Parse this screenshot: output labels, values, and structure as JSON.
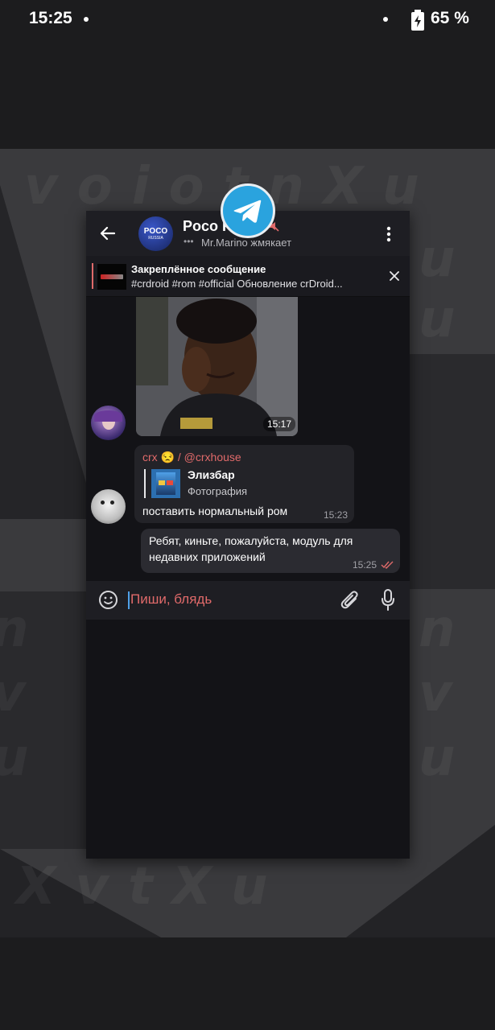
{
  "status_bar": {
    "time": "15:25",
    "battery": "65 %"
  },
  "chat": {
    "title": "Poco R",
    "typing_text": "Mr.Marino жмякает",
    "avatar_text": "POCO",
    "avatar_sub": "RUSSIA"
  },
  "pinned": {
    "title": "Закреплённое сообщение",
    "text": "#crdroid #rom #official Обновление crDroid..."
  },
  "messages": {
    "photo_time": "15:17",
    "reply": {
      "sender": "crx 😒 / @crxhouse",
      "quoted_name": "Элизбар",
      "quoted_type": "Фотография",
      "text": "поставить нормальный ром",
      "time": "15:23"
    },
    "outgoing": {
      "text_line1": "Ребят, киньте, пожалуйста, модуль для",
      "text_line2": "недавних приложений",
      "time": "15:25"
    }
  },
  "composer": {
    "placeholder": "Пиши, блядь"
  },
  "colors": {
    "accent_red": "#e06a6a",
    "telegram_blue": "#2aa3de",
    "card_bg": "#131317"
  }
}
